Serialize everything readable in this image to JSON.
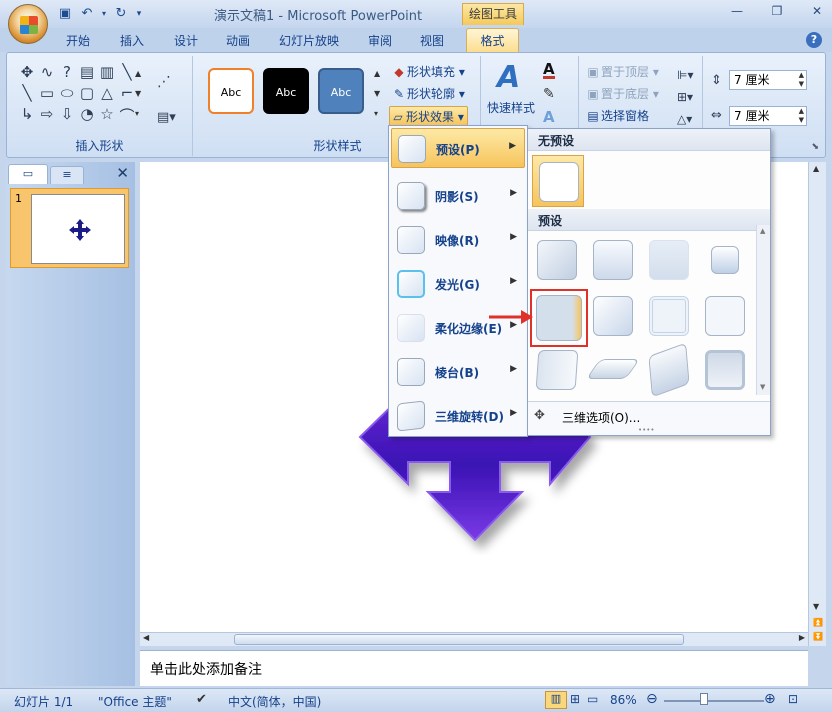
{
  "window": {
    "title": "演示文稿1 - Microsoft PowerPoint",
    "context_tab_group": "绘图工具"
  },
  "tabs": [
    {
      "label": "开始"
    },
    {
      "label": "插入"
    },
    {
      "label": "设计"
    },
    {
      "label": "动画"
    },
    {
      "label": "幻灯片放映"
    },
    {
      "label": "审阅"
    },
    {
      "label": "视图"
    },
    {
      "label": "格式"
    }
  ],
  "ribbon": {
    "insert_shapes": {
      "label": "插入形状"
    },
    "shape_styles": {
      "label": "形状样式",
      "styles": [
        {
          "text": "Abc",
          "fill": "#ffffff",
          "border": "#f0802a",
          "color": "#000000"
        },
        {
          "text": "Abc",
          "fill": "#000000",
          "border": "#000000",
          "color": "#ffffff"
        },
        {
          "text": "Abc",
          "fill": "#4f81bd",
          "border": "#385d8a",
          "color": "#ffffff"
        }
      ],
      "fill_label": "形状填充",
      "outline_label": "形状轮廓",
      "effects_label": "形状效果"
    },
    "art": {
      "quick_styles": "快速样式"
    },
    "arrange": {
      "bring_front": "置于顶层",
      "send_back": "置于底层",
      "selection_pane": "选择窗格"
    },
    "size": {
      "height": "7 厘米",
      "width": "7 厘米"
    }
  },
  "effects_menu": {
    "items": [
      {
        "label": "预设(P)"
      },
      {
        "label": "阴影(S)"
      },
      {
        "label": "映像(R)"
      },
      {
        "label": "发光(G)"
      },
      {
        "label": "柔化边缘(E)"
      },
      {
        "label": "棱台(B)"
      },
      {
        "label": "三维旋转(D)"
      }
    ]
  },
  "presets_panel": {
    "no_preset_header": "无预设",
    "presets_header": "预设",
    "more_options": "三维选项(O)..."
  },
  "slide_pane": {
    "slide_number": "1"
  },
  "notes": {
    "placeholder": "单击此处添加备注"
  },
  "status": {
    "slide_info": "幻灯片 1/1",
    "theme": "\"Office 主题\"",
    "language": "中文(简体，中国)",
    "zoom": "86%"
  },
  "colors": {
    "accent_gold": "#f7c45c",
    "highlight_red": "#e0302a",
    "shape_purple": "#5a21c9"
  }
}
